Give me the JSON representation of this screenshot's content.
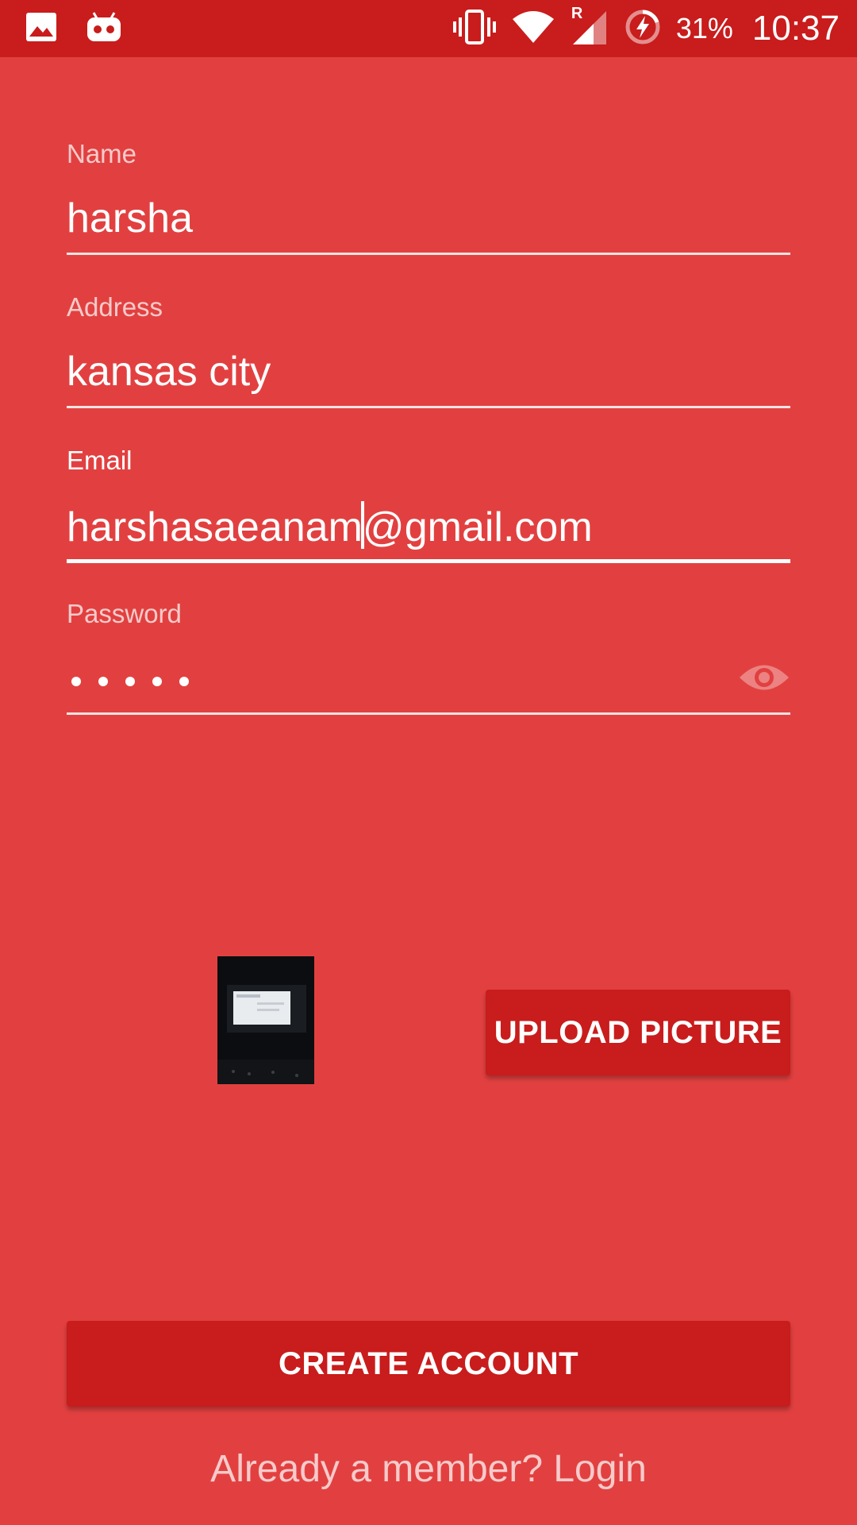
{
  "status_bar": {
    "battery_percent": "31%",
    "time": "10:37",
    "icons": [
      "image-icon",
      "android-debug-icon",
      "vibrate-icon",
      "wifi-icon",
      "signal-roaming-icon",
      "battery-charging-icon"
    ],
    "roaming_label": "R"
  },
  "form": {
    "name": {
      "label": "Name",
      "value": "harsha"
    },
    "address": {
      "label": "Address",
      "value": "kansas city"
    },
    "email": {
      "label": "Email",
      "value_before_caret": "harshasaeanam",
      "value_after_caret": "@gmail.com"
    },
    "password": {
      "label": "Password",
      "masked_length": 5,
      "toggle_icon": "eye-icon"
    }
  },
  "upload_label": "UPLOAD PICTURE",
  "create_account_label": "CREATE ACCOUNT",
  "login_link_text": "Already a member? Login",
  "colors": {
    "background": "#e24040",
    "status_bar": "#c91c1c",
    "button": "#c91c1c",
    "text": "#ffffff"
  }
}
